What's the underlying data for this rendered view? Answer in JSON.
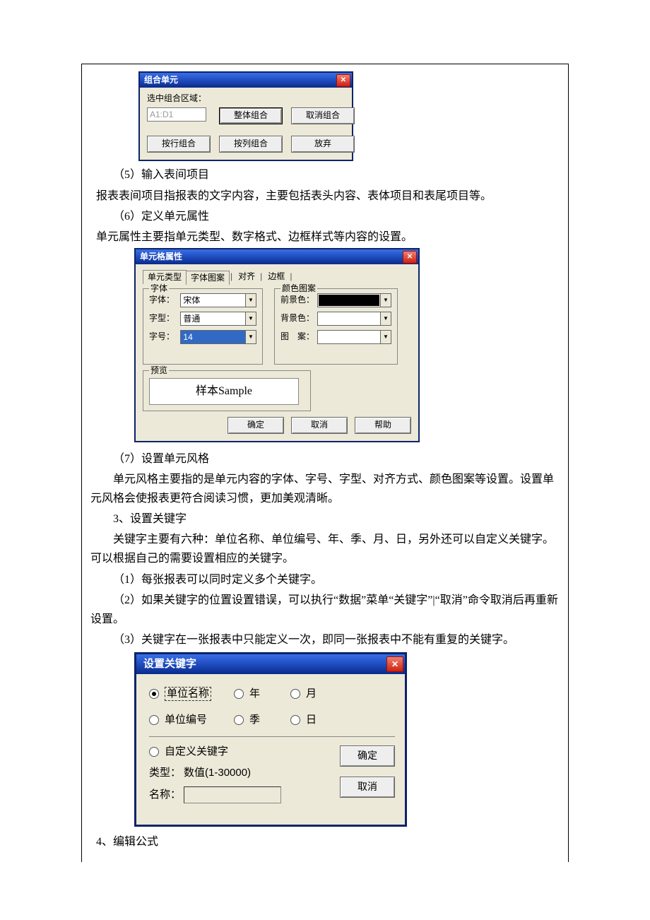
{
  "dlg1": {
    "title": "组合单元",
    "label_region": "选中组合区域：",
    "input_value": "A1:D1",
    "btn_whole": "整体组合",
    "btn_cancel_combine": "取消组合",
    "btn_by_row": "按行组合",
    "btn_by_col": "按列组合",
    "btn_abort": "放弃"
  },
  "text": {
    "p5_title": "（5）输入表间项目",
    "p5_body": "报表表间项目指报表的文字内容，主要包括表头内容、表体项目和表尾项目等。",
    "p6_title": "（6）定义单元属性",
    "p6_body": "单元属性主要指单元类型、数字格式、边框样式等内容的设置。",
    "p7_title": "（7）设置单元风格",
    "p7_body1": "单元风格主要指的是单元内容的字体、字号、字型、对齐方式、颜色图案等设置。设置单元风格会使报表更符合阅读习惯，更加美观清晰。",
    "p3_title": "3、设置关键字",
    "p3_body1": "关键字主要有六种：单位名称、单位编号、年、季、月、日，另外还可以自定义关键字。可以根据自己的需要设置相应的关键字。",
    "p3_b1": "（1）每张报表可以同时定义多个关键字。",
    "p3_b2": "（2）如果关键字的位置设置错误，可以执行“数据”菜单“关键字”|“取消”命令取消后再重新设置。",
    "p3_b3": "（3）关键字在一张报表中只能定义一次，即同一张报表中不能有重复的关键字。",
    "p4_title": "4、编辑公式"
  },
  "dlg2": {
    "title": "单元格属性",
    "tabs": [
      "单元类型",
      "字体图案",
      "对齐",
      "边框"
    ],
    "grp_font": "字体",
    "grp_color": "颜色图案",
    "lbl_font": "字体：",
    "lbl_style": "字型：",
    "lbl_size": "字号：",
    "val_font": "宋体",
    "val_style": "普通",
    "val_size": "14",
    "lbl_fg": "前景色：",
    "lbl_bg": "背景色：",
    "lbl_pat": "图　案：",
    "grp_preview": "预览",
    "preview_text": "样本Sample",
    "btn_ok": "确定",
    "btn_cancel": "取消",
    "btn_help": "帮助"
  },
  "dlg3": {
    "title": "设置关键字",
    "opt_unitname": "单位名称",
    "opt_year": "年",
    "opt_month": "月",
    "opt_unitcode": "单位编号",
    "opt_quarter": "季",
    "opt_day": "日",
    "opt_custom": "自定义关键字",
    "lbl_type": "类型：",
    "val_type": "数值(1-30000)",
    "lbl_name": "名称：",
    "btn_ok": "确定",
    "btn_cancel": "取消"
  }
}
